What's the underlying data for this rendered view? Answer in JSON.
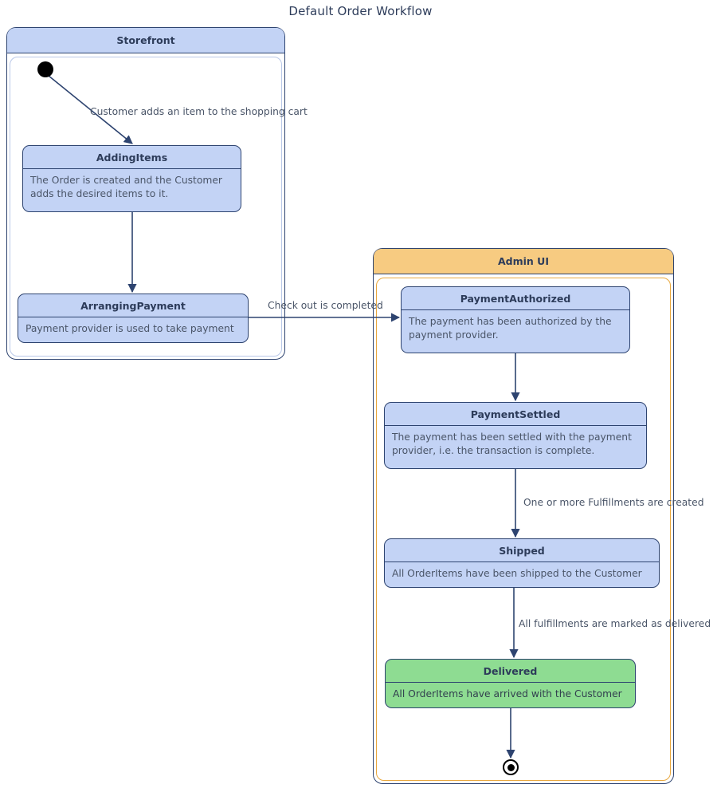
{
  "diagram": {
    "title": "Default Order Workflow",
    "type": "uml-state-machine",
    "colors": {
      "state_fill": "#c3d3f5",
      "state_border": "#2e4470",
      "final_state_fill": "#8edc92",
      "admin_header_fill": "#f7cb81",
      "admin_border": "#e9a83f",
      "text": "#4a5568",
      "title_text": "#2d3c5a"
    }
  },
  "containers": [
    {
      "id": "storefront",
      "label": "Storefront"
    },
    {
      "id": "adminui",
      "label": "Admin UI"
    }
  ],
  "states": {
    "adding_items": {
      "name": "AddingItems",
      "description": "The Order is created and the Customer adds the desired items to it."
    },
    "arranging_payment": {
      "name": "ArrangingPayment",
      "description": "Payment provider is used to take payment"
    },
    "payment_authorized": {
      "name": "PaymentAuthorized",
      "description": "The payment has been authorized by the payment provider."
    },
    "payment_settled": {
      "name": "PaymentSettled",
      "description": "The payment has been settled with the payment provider, i.e. the transaction is complete."
    },
    "shipped": {
      "name": "Shipped",
      "description": "All OrderItems have been shipped to the Customer"
    },
    "delivered": {
      "name": "Delivered",
      "description": "All OrderItems have arrived with the Customer"
    }
  },
  "transitions": {
    "start_to_adding": {
      "label": "Customer adds an item to the shopping cart"
    },
    "adding_to_arranging": {
      "label": ""
    },
    "arranging_to_authorized": {
      "label": "Check out is completed"
    },
    "authorized_to_settled": {
      "label": ""
    },
    "settled_to_shipped": {
      "label": "One or more Fulfillments are created"
    },
    "shipped_to_delivered": {
      "label": "All fulfillments are marked as delivered"
    },
    "delivered_to_end": {
      "label": ""
    }
  },
  "nodes": {
    "initial": "initial-state-node",
    "final": "final-state-node"
  }
}
